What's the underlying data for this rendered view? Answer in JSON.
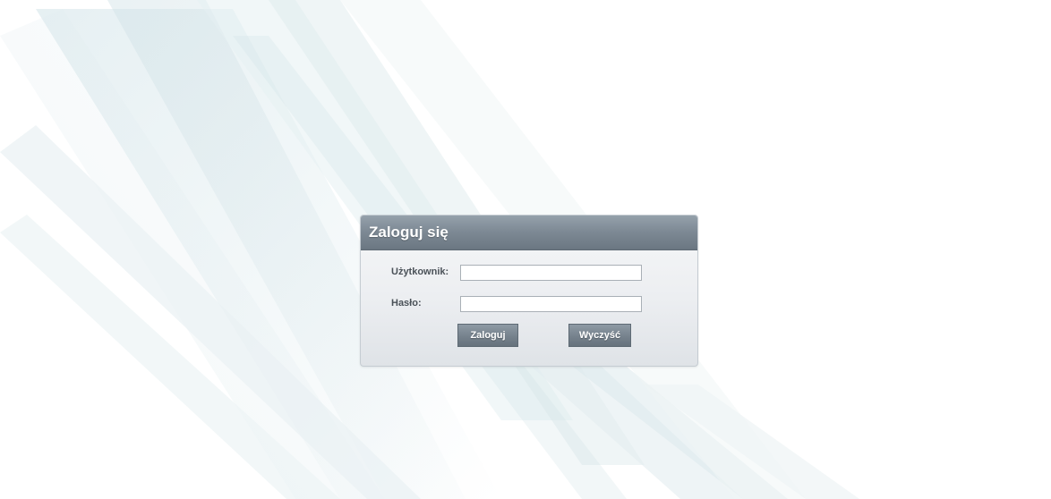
{
  "login": {
    "title": "Zaloguj się",
    "username_label": "Użytkownik:",
    "username_value": "",
    "password_label": "Hasło:",
    "password_value": "",
    "login_button": "Zaloguj",
    "clear_button": "Wyczyść"
  },
  "colors": {
    "header": "#7c8893",
    "panel": "#eceef1",
    "button": "#76828d",
    "background_streaks": "#d8e6ea"
  }
}
